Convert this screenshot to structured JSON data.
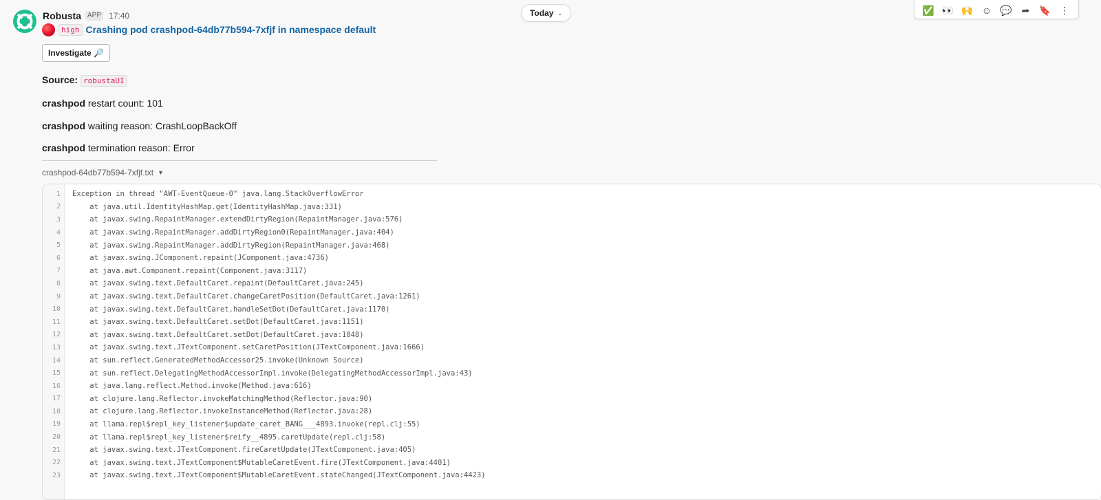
{
  "message": {
    "sender": "Robusta",
    "app_badge": "APP",
    "time": "17:40",
    "severity": "high",
    "title": "Crashing pod crashpod-64db77b594-7xfjf in namespace default",
    "investigate_label": "Investigate 🔎",
    "source_label": "Source:",
    "source_value": "robustaUI",
    "fields": [
      {
        "pod": "crashpod",
        "label": "restart count: 101"
      },
      {
        "pod": "crashpod",
        "label": "waiting reason: CrashLoopBackOff"
      },
      {
        "pod": "crashpod",
        "label": "termination reason: Error"
      }
    ],
    "file_name": "crashpod-64db77b594-7xfjf.txt"
  },
  "date_divider": {
    "label": "Today"
  },
  "colors": {
    "link": "#1264a3",
    "inline_code": "#e01e5a",
    "brand": "#1fbf8f"
  },
  "icons": {
    "avatar": "robusta-lifebuoy-icon",
    "severity": "red-circle-icon",
    "file_menu": "caret-down-icon",
    "today_menu": "chevron-down-icon"
  },
  "actions": [
    "✅",
    "👀",
    "🙌",
    "☺",
    "💬",
    "➦",
    "🔖",
    "⋮"
  ],
  "code": {
    "lines": [
      {
        "n": "1",
        "t": "Exception in thread \"AWT-EventQueue-0\" java.lang.StackOverflowError"
      },
      {
        "n": "2",
        "t": "    at java.util.IdentityHashMap.get(IdentityHashMap.java:331)"
      },
      {
        "n": "3",
        "t": "    at javax.swing.RepaintManager.extendDirtyRegion(RepaintManager.java:576)"
      },
      {
        "n": "4",
        "t": "    at javax.swing.RepaintManager.addDirtyRegion0(RepaintManager.java:404)"
      },
      {
        "n": "5",
        "t": "    at javax.swing.RepaintManager.addDirtyRegion(RepaintManager.java:468)"
      },
      {
        "n": "6",
        "t": "    at javax.swing.JComponent.repaint(JComponent.java:4736)"
      },
      {
        "n": "7",
        "t": "    at java.awt.Component.repaint(Component.java:3117)"
      },
      {
        "n": "8",
        "t": "    at javax.swing.text.DefaultCaret.repaint(DefaultCaret.java:245)"
      },
      {
        "n": "9",
        "t": "    at javax.swing.text.DefaultCaret.changeCaretPosition(DefaultCaret.java:1261)"
      },
      {
        "n": "10",
        "t": "    at javax.swing.text.DefaultCaret.handleSetDot(DefaultCaret.java:1170)"
      },
      {
        "n": "11",
        "t": "    at javax.swing.text.DefaultCaret.setDot(DefaultCaret.java:1151)"
      },
      {
        "n": "12",
        "t": "    at javax.swing.text.DefaultCaret.setDot(DefaultCaret.java:1048)"
      },
      {
        "n": "13",
        "t": "    at javax.swing.text.JTextComponent.setCaretPosition(JTextComponent.java:1666)"
      },
      {
        "n": "14",
        "t": "    at sun.reflect.GeneratedMethodAccessor25.invoke(Unknown Source)"
      },
      {
        "n": "15",
        "t": "    at sun.reflect.DelegatingMethodAccessorImpl.invoke(DelegatingMethodAccessorImpl.java:43)"
      },
      {
        "n": "16",
        "t": "    at java.lang.reflect.Method.invoke(Method.java:616)"
      },
      {
        "n": "17",
        "t": "    at clojure.lang.Reflector.invokeMatchingMethod(Reflector.java:90)"
      },
      {
        "n": "18",
        "t": "    at clojure.lang.Reflector.invokeInstanceMethod(Reflector.java:28)"
      },
      {
        "n": "19",
        "t": "    at llama.repl$repl_key_listener$update_caret_BANG___4893.invoke(repl.clj:55)"
      },
      {
        "n": "20",
        "t": "    at llama.repl$repl_key_listener$reify__4895.caretUpdate(repl.clj:58)"
      },
      {
        "n": "21",
        "t": "    at javax.swing.text.JTextComponent.fireCaretUpdate(JTextComponent.java:405)"
      },
      {
        "n": "22",
        "t": "    at javax.swing.text.JTextComponent$MutableCaretEvent.fire(JTextComponent.java:4401)"
      },
      {
        "n": "23",
        "t": "    at javax.swing.text.JTextComponent$MutableCaretEvent.stateChanged(JTextComponent.java:4423)"
      }
    ]
  }
}
